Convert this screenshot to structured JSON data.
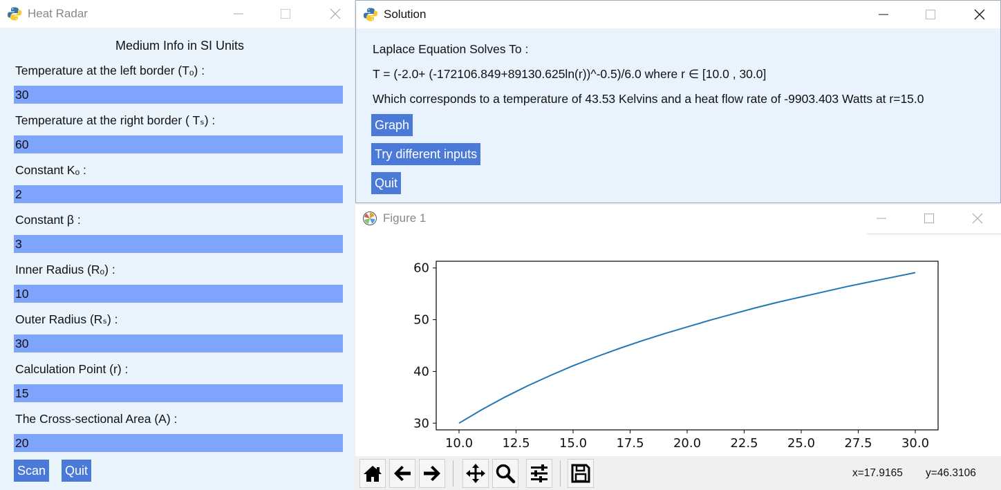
{
  "heat_radar": {
    "title": "Heat Radar",
    "heading": "Medium Info in SI Units",
    "fields": [
      {
        "label": "Temperature at the left border (Tₒ) :",
        "value": "30"
      },
      {
        "label": "Temperature at the right border ( Tₛ) :",
        "value": "60"
      },
      {
        "label": "Constant Kₒ :",
        "value": "2"
      },
      {
        "label": "Constant β  :",
        "value": "3"
      },
      {
        "label": "Inner Radius (Rₒ) :",
        "value": "10"
      },
      {
        "label": "Outer Radius (Rₛ) :",
        "value": "30"
      },
      {
        "label": "Calculation Point (r) :",
        "value": "15"
      },
      {
        "label": "The Cross-sectional Area (A) :",
        "value": "20"
      }
    ],
    "scan_label": "Scan",
    "quit_label": "Quit"
  },
  "solution": {
    "title": "Solution",
    "line1": "Laplace Equation Solves To :",
    "line2": "T = (-2.0+ (-172106.849+89130.625ln(r))^-0.5)/6.0 where r ∈ [10.0 , 30.0]",
    "line3": "Which corresponds to a temperature of 43.53 Kelvins and a heat flow rate of -9903.403 Watts at r=15.0",
    "graph_label": "Graph",
    "try_label": "Try different inputs",
    "quit_label": "Quit"
  },
  "figure": {
    "title": "Figure 1",
    "coord_x": "x=17.9165",
    "coord_y": "y=46.3106",
    "colors": {
      "line": "#1f77b4"
    },
    "toolbar_icons": [
      "home-icon",
      "back-arrow-icon",
      "forward-arrow-icon",
      "pan-icon",
      "zoom-icon",
      "configure-icon",
      "save-icon"
    ]
  },
  "chart_data": {
    "type": "line",
    "title": "",
    "xlabel": "",
    "ylabel": "",
    "xlim": [
      9.0,
      31.0
    ],
    "ylim": [
      28.7,
      61.3
    ],
    "xticks": [
      10.0,
      12.5,
      15.0,
      17.5,
      20.0,
      22.5,
      25.0,
      27.5,
      30.0
    ],
    "xtick_labels": [
      "10.0",
      "12.5",
      "15.0",
      "17.5",
      "20.0",
      "22.5",
      "25.0",
      "27.5",
      "30.0"
    ],
    "yticks": [
      30,
      40,
      50,
      60
    ],
    "ytick_labels": [
      "30",
      "40",
      "50",
      "60"
    ],
    "grid": false,
    "series": [
      {
        "x": [
          10,
          11,
          12,
          13,
          14,
          15,
          16,
          17,
          18,
          19,
          20,
          21,
          22,
          23,
          24,
          25,
          26,
          27,
          28,
          29,
          30
        ],
        "y": [
          30.0,
          32.6,
          35.0,
          37.2,
          39.2,
          41.1,
          42.8,
          44.4,
          45.9,
          47.3,
          48.6,
          49.9,
          51.1,
          52.3,
          53.4,
          54.4,
          55.4,
          56.4,
          57.3,
          58.2,
          59.1
        ]
      }
    ]
  }
}
